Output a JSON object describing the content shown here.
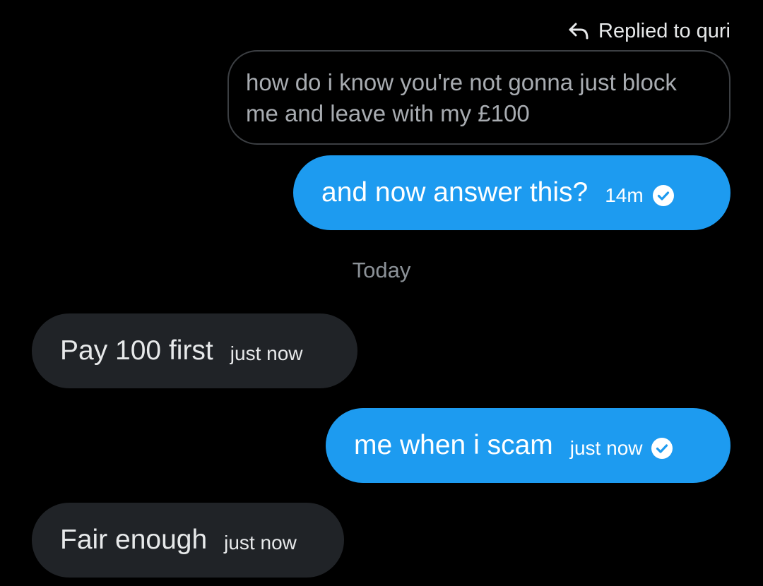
{
  "reply_header": {
    "icon": "reply-arrow-icon",
    "label": "Replied to quri"
  },
  "quoted_message": {
    "text": "how do i know you're not gonna just block me and leave with my £100"
  },
  "messages": [
    {
      "direction": "sent",
      "text": "and now answer this?",
      "time": "14m",
      "status_icon": "check-circle-icon"
    },
    {
      "direction": "received",
      "text": "Pay 100 first",
      "time": "just now"
    },
    {
      "direction": "sent",
      "text": "me when i scam",
      "time": "just now",
      "status_icon": "check-circle-icon"
    },
    {
      "direction": "received",
      "text": "Fair enough",
      "time": "just now"
    }
  ],
  "date_separator": "Today",
  "colors": {
    "background": "#000000",
    "sent_bubble": "#1d9bf0",
    "received_bubble": "#202327",
    "quote_border": "#3c3f43",
    "muted_text": "#8b9197"
  }
}
